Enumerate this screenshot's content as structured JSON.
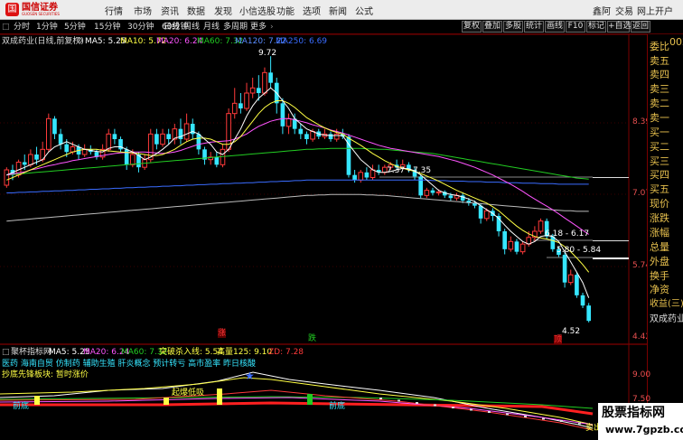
{
  "app": {
    "logo_text": "国信证券",
    "logo_sub": "GUOSEN SECURITIES",
    "logo_mark": "国"
  },
  "menu": [
    "行情",
    "市场",
    "资讯",
    "数据",
    "发现",
    "小信选股",
    "功能",
    "选项",
    "新闻",
    "公式"
  ],
  "top_right": [
    "鑫阿",
    "交易",
    "网上开户"
  ],
  "periods": [
    "分时",
    "1分钟",
    "5分钟",
    "15分钟",
    "30分钟",
    "60分钟",
    "日线",
    "周线",
    "月线",
    "多周期",
    "更多"
  ],
  "active_period": "日线",
  "right_buttons": [
    "复权",
    "叠加",
    "多股",
    "统计",
    "画线",
    "F10",
    "标记",
    "+自选",
    "返回"
  ],
  "stock_code_tag": "002",
  "main_legend": {
    "title": "双成药业(日线,前复权)",
    "ma5": "MA5: 5.25",
    "ma10": "MA10: 5.72",
    "ma20": "MA20: 6.24",
    "ma60": "MA60: 7.32",
    "ma120": "MA120: 7.22",
    "ma250": "MA250: 6.69"
  },
  "price_axis": [
    "8.39",
    "7.07",
    "5.74",
    "4.42"
  ],
  "price_labels": {
    "high": "9.72",
    "p1": "7.37 - 7.35",
    "p2": "6.18 - 6.17",
    "p3": "5.80 - 5.84",
    "low": "4.52"
  },
  "markers": {
    "zhang": "涨",
    "die": "跌",
    "ding": "顶"
  },
  "right_panel": {
    "labels": [
      "委比",
      "卖五",
      "卖四",
      "卖三",
      "卖二",
      "卖一",
      "买一",
      "买二",
      "买三",
      "买四",
      "买五",
      "现价",
      "涨跌",
      "涨幅",
      "总量",
      "外盘",
      "换手",
      "净资",
      "收益(三)"
    ],
    "stock_name": "双成药业"
  },
  "sub_legend": {
    "title": "聚杯指标网",
    "ma5": "MA5: 5.25",
    "ma20": "MA20: 6.24",
    "ma60": "MA60: 7.32",
    "breakout": "突破杀入线: 5.54",
    "high125": "高量125: 9.10",
    "zd": "ZD: 7.28"
  },
  "sub_text": {
    "concepts": "医药 海南自贸 仿制药 辅助生殖 肝炎概念 预计转亏 高市盈率 昨日核酸",
    "bottom_fish": "抄底先锋板块: 暂时涨价",
    "red_gauge": "起爆低吸",
    "qiandi1": "前底",
    "qiandi2": "前底",
    "sell": "卖出",
    "axis_900": "9.00",
    "axis_750": "7.50"
  },
  "watermark": {
    "line1": "股票指标网",
    "line2": "www.7gpzb.com"
  },
  "colors": {
    "up": "#ff3a3a",
    "down": "#36e6ff",
    "ma5": "#ffffff",
    "ma10": "#ffff44",
    "ma20": "#ff55ff",
    "ma60": "#22cc22",
    "ma120": "#3a6cff",
    "ma250": "#bbbbbb"
  },
  "chart_data": {
    "type": "candlestick",
    "ylim": [
      4.2,
      9.9
    ],
    "candles": [
      [
        7.2,
        7.5,
        7.55,
        7.15
      ],
      [
        7.5,
        7.4,
        7.6,
        7.3
      ],
      [
        7.4,
        7.65,
        7.7,
        7.35
      ],
      [
        7.65,
        7.6,
        7.8,
        7.5
      ],
      [
        7.6,
        7.8,
        7.9,
        7.55
      ],
      [
        7.8,
        7.7,
        7.95,
        7.6
      ],
      [
        7.7,
        7.9,
        8.05,
        7.65
      ],
      [
        7.9,
        8.5,
        8.6,
        7.85
      ],
      [
        8.5,
        8.2,
        8.55,
        8.1
      ],
      [
        8.2,
        8.0,
        8.3,
        7.9
      ],
      [
        8.0,
        7.85,
        8.1,
        7.75
      ],
      [
        7.85,
        7.95,
        8.05,
        7.8
      ],
      [
        7.95,
        7.8,
        8.0,
        7.7
      ],
      [
        7.8,
        7.9,
        8.0,
        7.75
      ],
      [
        7.9,
        7.85,
        7.98,
        7.8
      ],
      [
        7.85,
        7.75,
        7.9,
        7.7
      ],
      [
        7.75,
        7.9,
        8.0,
        7.7
      ],
      [
        7.9,
        8.2,
        8.3,
        7.85
      ],
      [
        8.2,
        8.1,
        8.3,
        8.0
      ],
      [
        8.1,
        7.9,
        8.15,
        7.85
      ],
      [
        7.9,
        7.6,
        7.95,
        7.5
      ],
      [
        7.6,
        7.8,
        7.9,
        7.55
      ],
      [
        7.8,
        7.55,
        7.85,
        7.45
      ],
      [
        7.55,
        7.7,
        7.8,
        7.5
      ],
      [
        7.7,
        8.2,
        8.3,
        7.65
      ],
      [
        8.2,
        8.0,
        8.3,
        7.9
      ],
      [
        8.0,
        8.2,
        8.3,
        7.95
      ],
      [
        8.2,
        8.1,
        8.3,
        8.0
      ],
      [
        8.1,
        8.3,
        8.4,
        8.0
      ],
      [
        8.3,
        8.1,
        8.5,
        8.0
      ],
      [
        8.1,
        8.4,
        8.6,
        8.05
      ],
      [
        8.4,
        8.2,
        8.5,
        8.1
      ],
      [
        8.2,
        7.9,
        8.25,
        7.8
      ],
      [
        7.9,
        7.7,
        7.95,
        7.6
      ],
      [
        7.7,
        7.75,
        7.85,
        7.6
      ],
      [
        7.75,
        7.6,
        7.85,
        7.55
      ],
      [
        7.6,
        7.9,
        8.0,
        7.55
      ],
      [
        7.9,
        8.6,
        8.7,
        7.85
      ],
      [
        8.6,
        8.8,
        9.1,
        8.5
      ],
      [
        8.8,
        8.7,
        9.0,
        8.6
      ],
      [
        8.7,
        9.0,
        9.2,
        8.65
      ],
      [
        9.0,
        9.1,
        9.3,
        8.9
      ],
      [
        9.1,
        9.0,
        9.35,
        8.85
      ],
      [
        9.0,
        9.4,
        9.5,
        8.95
      ],
      [
        9.4,
        9.2,
        9.72,
        9.1
      ],
      [
        9.2,
        8.8,
        9.3,
        8.6
      ],
      [
        8.8,
        8.35,
        8.9,
        8.2
      ],
      [
        8.35,
        8.5,
        8.6,
        8.2
      ],
      [
        8.5,
        8.3,
        8.6,
        8.2
      ],
      [
        8.3,
        8.2,
        8.4,
        8.1
      ],
      [
        8.2,
        8.1,
        8.25,
        8.0
      ],
      [
        8.1,
        8.25,
        8.3,
        8.05
      ],
      [
        8.25,
        8.15,
        8.3,
        8.1
      ],
      [
        8.15,
        8.2,
        8.3,
        8.1
      ],
      [
        8.2,
        8.1,
        8.25,
        8.05
      ],
      [
        8.1,
        8.2,
        8.3,
        8.05
      ],
      [
        8.2,
        8.15,
        8.3,
        8.1
      ],
      [
        8.15,
        7.4,
        8.2,
        7.35
      ],
      [
        7.4,
        7.3,
        7.5,
        7.25
      ],
      [
        7.3,
        7.45,
        7.5,
        7.25
      ],
      [
        7.45,
        7.35,
        7.55,
        7.3
      ],
      [
        7.35,
        7.5,
        7.6,
        7.3
      ],
      [
        7.5,
        7.45,
        7.6,
        7.4
      ],
      [
        7.45,
        7.55,
        7.6,
        7.4
      ],
      [
        7.55,
        7.6,
        7.65,
        7.5
      ],
      [
        7.6,
        7.55,
        7.7,
        7.5
      ],
      [
        7.55,
        7.6,
        7.7,
        7.5
      ],
      [
        7.6,
        7.5,
        7.65,
        7.45
      ],
      [
        7.5,
        7.37,
        7.55,
        7.3
      ],
      [
        7.37,
        7.0,
        7.4,
        6.95
      ],
      [
        7.0,
        7.1,
        7.15,
        6.95
      ],
      [
        7.1,
        7.05,
        7.15,
        7.0
      ],
      [
        7.05,
        7.07,
        7.12,
        7.0
      ],
      [
        7.07,
        7.0,
        7.1,
        6.95
      ],
      [
        7.0,
        6.95,
        7.05,
        6.9
      ],
      [
        6.95,
        7.0,
        7.05,
        6.9
      ],
      [
        7.0,
        6.9,
        7.05,
        6.85
      ],
      [
        6.9,
        6.85,
        6.95,
        6.8
      ],
      [
        6.85,
        6.8,
        6.9,
        6.75
      ],
      [
        6.8,
        6.55,
        6.85,
        6.45
      ],
      [
        6.55,
        6.7,
        6.75,
        6.5
      ],
      [
        6.7,
        6.6,
        6.75,
        6.5
      ],
      [
        6.6,
        6.3,
        6.65,
        6.2
      ],
      [
        6.3,
        5.95,
        6.35,
        5.85
      ],
      [
        5.95,
        6.1,
        6.2,
        5.9
      ],
      [
        6.1,
        5.9,
        6.15,
        5.85
      ],
      [
        5.9,
        6.05,
        6.1,
        5.85
      ],
      [
        6.05,
        6.18,
        6.3,
        6.0
      ],
      [
        6.18,
        6.3,
        6.4,
        6.1
      ],
      [
        6.3,
        6.5,
        6.55,
        6.25
      ],
      [
        6.5,
        6.2,
        6.55,
        6.15
      ],
      [
        6.2,
        5.95,
        6.25,
        5.9
      ],
      [
        5.95,
        5.84,
        6.0,
        5.8
      ],
      [
        5.84,
        5.3,
        5.9,
        5.2
      ],
      [
        5.3,
        5.45,
        5.55,
        5.25
      ],
      [
        5.45,
        5.05,
        5.5,
        5.0
      ],
      [
        5.05,
        4.85,
        5.1,
        4.8
      ],
      [
        4.85,
        4.55,
        4.9,
        4.52
      ]
    ],
    "ma5": [
      7.4,
      7.45,
      7.5,
      7.55,
      7.6,
      7.65,
      7.7,
      7.85,
      7.95,
      8.0,
      8.05,
      8.0,
      7.95,
      7.9,
      7.88,
      7.86,
      7.85,
      7.92,
      7.95,
      7.95,
      7.9,
      7.85,
      7.78,
      7.7,
      7.75,
      7.82,
      7.9,
      8.0,
      8.12,
      8.15,
      8.2,
      8.25,
      8.2,
      8.1,
      8.0,
      7.85,
      7.8,
      7.9,
      8.1,
      8.3,
      8.55,
      8.75,
      8.9,
      9.0,
      9.1,
      9.0,
      8.85,
      8.7,
      8.5,
      8.4,
      8.3,
      8.25,
      8.2,
      8.18,
      8.17,
      8.17,
      8.17,
      8.0,
      7.85,
      7.7,
      7.6,
      7.5,
      7.45,
      7.45,
      7.47,
      7.5,
      7.53,
      7.52,
      7.48,
      7.4,
      7.3,
      7.2,
      7.1,
      7.05,
      7.02,
      7.0,
      6.97,
      6.93,
      6.88,
      6.8,
      6.72,
      6.65,
      6.55,
      6.42,
      6.3,
      6.2,
      6.1,
      6.05,
      6.1,
      6.2,
      6.22,
      6.2,
      6.1,
      5.9,
      5.7,
      5.5,
      5.3,
      5.0
    ],
    "ma10": [
      7.3,
      7.35,
      7.4,
      7.45,
      7.5,
      7.55,
      7.6,
      7.65,
      7.7,
      7.75,
      7.8,
      7.85,
      7.88,
      7.9,
      7.9,
      7.9,
      7.88,
      7.87,
      7.86,
      7.85,
      7.84,
      7.83,
      7.82,
      7.8,
      7.78,
      7.78,
      7.8,
      7.85,
      7.9,
      7.98,
      8.05,
      8.1,
      8.12,
      8.12,
      8.1,
      8.05,
      8.0,
      8.0,
      8.05,
      8.15,
      8.3,
      8.45,
      8.6,
      8.72,
      8.8,
      8.85,
      8.85,
      8.8,
      8.72,
      8.62,
      8.52,
      8.45,
      8.38,
      8.32,
      8.27,
      8.23,
      8.2,
      8.12,
      8.05,
      7.98,
      7.9,
      7.82,
      7.75,
      7.68,
      7.62,
      7.57,
      7.53,
      7.5,
      7.47,
      7.43,
      7.38,
      7.33,
      7.28,
      7.22,
      7.16,
      7.1,
      7.05,
      7.0,
      6.95,
      6.9,
      6.85,
      6.78,
      6.7,
      6.6,
      6.5,
      6.4,
      6.32,
      6.25,
      6.2,
      6.17,
      6.15,
      6.12,
      6.08,
      6.0,
      5.9,
      5.78,
      5.65,
      5.5
    ],
    "ma20": [
      7.4,
      7.42,
      7.44,
      7.46,
      7.5,
      7.52,
      7.55,
      7.58,
      7.6,
      7.63,
      7.65,
      7.68,
      7.7,
      7.72,
      7.74,
      7.76,
      7.78,
      7.8,
      7.82,
      7.83,
      7.84,
      7.85,
      7.85,
      7.85,
      7.84,
      7.83,
      7.82,
      7.83,
      7.85,
      7.88,
      7.92,
      7.96,
      8.0,
      8.02,
      8.04,
      8.05,
      8.06,
      8.07,
      8.1,
      8.15,
      8.2,
      8.28,
      8.35,
      8.4,
      8.45,
      8.48,
      8.5,
      8.5,
      8.48,
      8.45,
      8.42,
      8.38,
      8.35,
      8.32,
      8.28,
      8.25,
      8.22,
      8.18,
      8.14,
      8.1,
      8.06,
      8.02,
      7.98,
      7.95,
      7.92,
      7.9,
      7.88,
      7.86,
      7.84,
      7.82,
      7.8,
      7.78,
      7.76,
      7.73,
      7.7,
      7.67,
      7.63,
      7.59,
      7.55,
      7.5,
      7.45,
      7.4,
      7.34,
      7.28,
      7.22,
      7.15,
      7.08,
      7.0,
      6.93,
      6.86,
      6.79,
      6.72,
      6.64,
      6.56,
      6.48,
      6.4,
      6.32,
      6.24
    ],
    "ma60": [
      7.4,
      7.41,
      7.42,
      7.43,
      7.44,
      7.45,
      7.46,
      7.47,
      7.48,
      7.49,
      7.5,
      7.51,
      7.52,
      7.53,
      7.54,
      7.55,
      7.56,
      7.57,
      7.58,
      7.59,
      7.6,
      7.61,
      7.62,
      7.63,
      7.64,
      7.65,
      7.66,
      7.67,
      7.68,
      7.69,
      7.7,
      7.71,
      7.72,
      7.73,
      7.74,
      7.75,
      7.76,
      7.77,
      7.78,
      7.79,
      7.8,
      7.81,
      7.82,
      7.83,
      7.84,
      7.85,
      7.86,
      7.87,
      7.88,
      7.89,
      7.9,
      7.9,
      7.91,
      7.91,
      7.92,
      7.92,
      7.92,
      7.92,
      7.92,
      7.92,
      7.91,
      7.91,
      7.9,
      7.9,
      7.89,
      7.88,
      7.87,
      7.86,
      7.85,
      7.84,
      7.83,
      7.82,
      7.8,
      7.78,
      7.76,
      7.74,
      7.72,
      7.7,
      7.68,
      7.66,
      7.64,
      7.62,
      7.6,
      7.58,
      7.56,
      7.54,
      7.52,
      7.5,
      7.48,
      7.46,
      7.44,
      7.42,
      7.4,
      7.38,
      7.36,
      7.34,
      7.33,
      7.32
    ],
    "ma120": [
      7.05,
      7.05,
      7.06,
      7.06,
      7.07,
      7.07,
      7.08,
      7.08,
      7.09,
      7.09,
      7.1,
      7.1,
      7.11,
      7.11,
      7.12,
      7.12,
      7.13,
      7.13,
      7.14,
      7.14,
      7.15,
      7.15,
      7.16,
      7.16,
      7.17,
      7.17,
      7.18,
      7.18,
      7.19,
      7.19,
      7.2,
      7.2,
      7.21,
      7.21,
      7.22,
      7.22,
      7.23,
      7.23,
      7.24,
      7.24,
      7.25,
      7.25,
      7.26,
      7.26,
      7.27,
      7.27,
      7.28,
      7.28,
      7.29,
      7.29,
      7.3,
      7.3,
      7.3,
      7.3,
      7.3,
      7.3,
      7.3,
      7.3,
      7.3,
      7.3,
      7.3,
      7.3,
      7.3,
      7.3,
      7.3,
      7.3,
      7.3,
      7.3,
      7.3,
      7.3,
      7.3,
      7.29,
      7.29,
      7.29,
      7.28,
      7.28,
      7.28,
      7.27,
      7.27,
      7.27,
      7.26,
      7.26,
      7.26,
      7.25,
      7.25,
      7.25,
      7.24,
      7.24,
      7.24,
      7.23,
      7.23,
      7.23,
      7.22,
      7.22,
      7.22,
      7.22,
      7.22,
      7.22
    ],
    "ma250": [
      6.5,
      6.51,
      6.52,
      6.53,
      6.54,
      6.55,
      6.56,
      6.57,
      6.58,
      6.59,
      6.6,
      6.61,
      6.62,
      6.63,
      6.64,
      6.65,
      6.66,
      6.67,
      6.68,
      6.69,
      6.7,
      6.71,
      6.72,
      6.73,
      6.74,
      6.75,
      6.76,
      6.77,
      6.78,
      6.79,
      6.8,
      6.81,
      6.82,
      6.83,
      6.84,
      6.85,
      6.86,
      6.87,
      6.88,
      6.89,
      6.9,
      6.91,
      6.92,
      6.93,
      6.94,
      6.95,
      6.96,
      6.97,
      6.98,
      6.99,
      7.0,
      7.0,
      7.01,
      7.01,
      7.02,
      7.02,
      7.02,
      7.02,
      7.02,
      7.02,
      7.01,
      7.01,
      7.0,
      7.0,
      6.99,
      6.98,
      6.97,
      6.96,
      6.95,
      6.94,
      6.93,
      6.92,
      6.91,
      6.9,
      6.89,
      6.88,
      6.87,
      6.86,
      6.85,
      6.84,
      6.83,
      6.82,
      6.81,
      6.8,
      6.79,
      6.78,
      6.77,
      6.76,
      6.75,
      6.74,
      6.73,
      6.72,
      6.71,
      6.7,
      6.7,
      6.69,
      6.69,
      6.69
    ]
  }
}
